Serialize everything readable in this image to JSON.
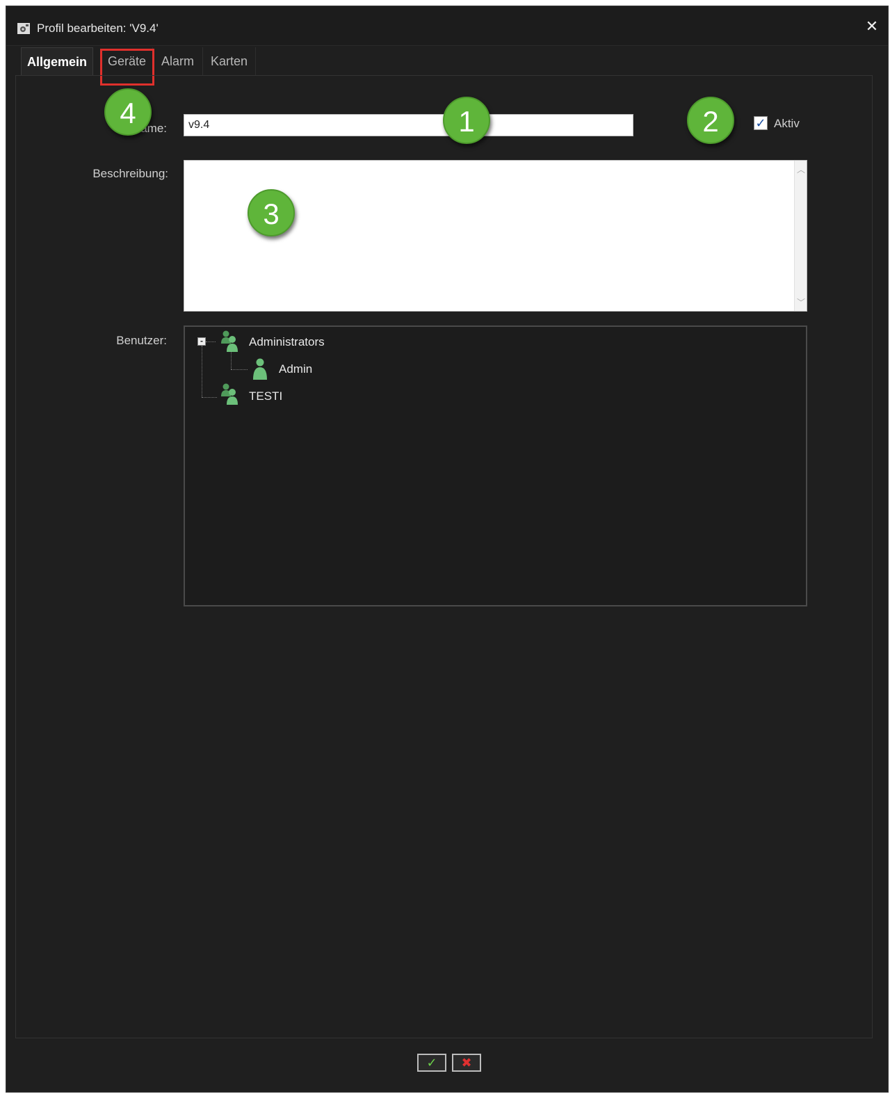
{
  "window": {
    "title": "Profil bearbeiten: 'V9.4'"
  },
  "tabs": [
    {
      "label": "Allgemein",
      "active": true
    },
    {
      "label": "Geräte",
      "active": false
    },
    {
      "label": "Alarm",
      "active": false
    },
    {
      "label": "Karten",
      "active": false
    }
  ],
  "form": {
    "name_label": "Name:",
    "name_value": "v9.4",
    "active_label": "Aktiv",
    "active_checked": true,
    "description_label": "Beschreibung:",
    "description_value": "",
    "users_label": "Benutzer:"
  },
  "users_tree": [
    {
      "label": "Administrators",
      "type": "group",
      "expanded": true,
      "children": [
        {
          "label": "Admin",
          "type": "user"
        }
      ]
    },
    {
      "label": "TESTI",
      "type": "group"
    }
  ],
  "markers": [
    "1",
    "2",
    "3",
    "4"
  ],
  "footer": {
    "ok_icon": "check-icon",
    "cancel_icon": "x-icon"
  },
  "colors": {
    "marker_green": "#5fb53a",
    "highlight_red": "#e0302c",
    "background": "#1f1f1f"
  }
}
